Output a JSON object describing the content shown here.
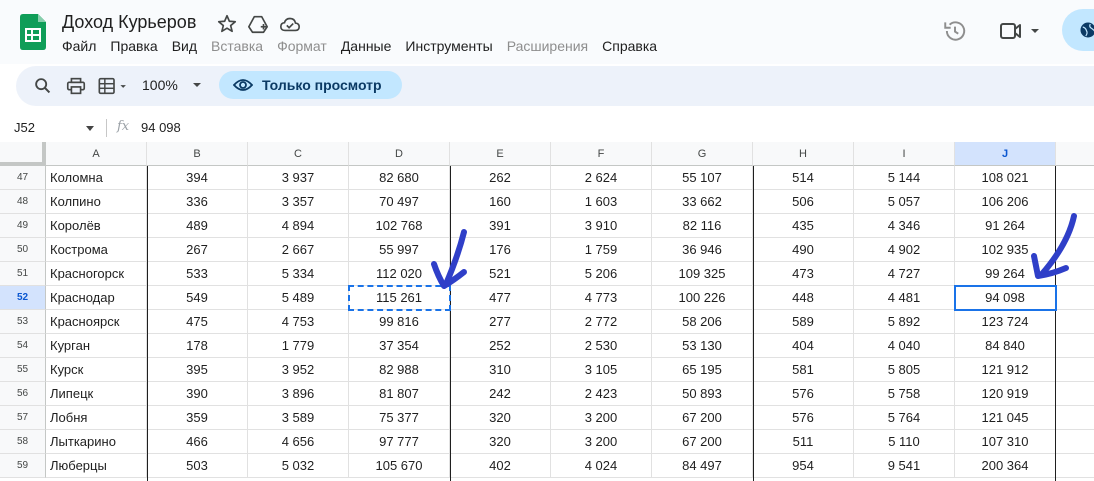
{
  "window": {
    "title": "Доход Курьеров",
    "icons": [
      "sheets-logo-icon",
      "star-icon",
      "move-to-drive-icon",
      "cloud-saved-icon",
      "history-icon",
      "meet-icon",
      "share-icon"
    ]
  },
  "menu": [
    {
      "label": "Файл",
      "enabled": true
    },
    {
      "label": "Правка",
      "enabled": true
    },
    {
      "label": "Вид",
      "enabled": true
    },
    {
      "label": "Вставка",
      "enabled": false
    },
    {
      "label": "Формат",
      "enabled": false
    },
    {
      "label": "Данные",
      "enabled": true
    },
    {
      "label": "Инструменты",
      "enabled": true
    },
    {
      "label": "Расширения",
      "enabled": false
    },
    {
      "label": "Справка",
      "enabled": true
    }
  ],
  "toolbar": {
    "zoom": "100%",
    "view_only_label": "Только просмотр",
    "icons": [
      "search-icon",
      "print-icon",
      "table-view-icon",
      "eye-icon"
    ]
  },
  "formula_bar": {
    "name_box": "J52",
    "fx_label": "fx",
    "value": "94 098"
  },
  "grid": {
    "columns": [
      "A",
      "B",
      "C",
      "D",
      "E",
      "F",
      "G",
      "H",
      "I",
      "J"
    ],
    "selected_column": "J",
    "selected_row": "52",
    "selected_cell": "J52",
    "copied_cell": "D52",
    "rows": [
      {
        "num": "47",
        "cells": [
          "Коломна",
          "394",
          "3 937",
          "82 680",
          "262",
          "2 624",
          "55 107",
          "514",
          "5 144",
          "108 021"
        ]
      },
      {
        "num": "48",
        "cells": [
          "Колпино",
          "336",
          "3 357",
          "70 497",
          "160",
          "1 603",
          "33 662",
          "506",
          "5 057",
          "106 206"
        ]
      },
      {
        "num": "49",
        "cells": [
          "Королёв",
          "489",
          "4 894",
          "102 768",
          "391",
          "3 910",
          "82 116",
          "435",
          "4 346",
          "91 264"
        ]
      },
      {
        "num": "50",
        "cells": [
          "Кострома",
          "267",
          "2 667",
          "55 997",
          "176",
          "1 759",
          "36 946",
          "490",
          "4 902",
          "102 935"
        ]
      },
      {
        "num": "51",
        "cells": [
          "Красногорск",
          "533",
          "5 334",
          "112 020",
          "521",
          "5 206",
          "109 325",
          "473",
          "4 727",
          "99 264"
        ]
      },
      {
        "num": "52",
        "cells": [
          "Краснодар",
          "549",
          "5 489",
          "115 261",
          "477",
          "4 773",
          "100 226",
          "448",
          "4 481",
          "94 098"
        ]
      },
      {
        "num": "53",
        "cells": [
          "Красноярск",
          "475",
          "4 753",
          "99 816",
          "277",
          "2 772",
          "58 206",
          "589",
          "5 892",
          "123 724"
        ]
      },
      {
        "num": "54",
        "cells": [
          "Курган",
          "178",
          "1 779",
          "37 354",
          "252",
          "2 530",
          "53 130",
          "404",
          "4 040",
          "84 840"
        ]
      },
      {
        "num": "55",
        "cells": [
          "Курск",
          "395",
          "3 952",
          "82 988",
          "310",
          "3 105",
          "65 195",
          "581",
          "5 805",
          "121 912"
        ]
      },
      {
        "num": "56",
        "cells": [
          "Липецк",
          "390",
          "3 896",
          "81 807",
          "242",
          "2 423",
          "50 893",
          "576",
          "5 758",
          "120 919"
        ]
      },
      {
        "num": "57",
        "cells": [
          "Лобня",
          "359",
          "3 589",
          "75 377",
          "320",
          "3 200",
          "67 200",
          "576",
          "5 764",
          "121 045"
        ]
      },
      {
        "num": "58",
        "cells": [
          "Лыткарино",
          "466",
          "4 656",
          "97 777",
          "320",
          "3 200",
          "67 200",
          "511",
          "5 110",
          "107 310"
        ]
      },
      {
        "num": "59",
        "cells": [
          "Люберцы",
          "503",
          "5 032",
          "105 670",
          "402",
          "4 024",
          "84 497",
          "954",
          "9 541",
          "200 364"
        ]
      }
    ]
  },
  "annotations": {
    "arrow_color": "#2f3fc8",
    "arrows": [
      "arrow-to-copied-cell",
      "arrow-to-selected-cell"
    ]
  }
}
